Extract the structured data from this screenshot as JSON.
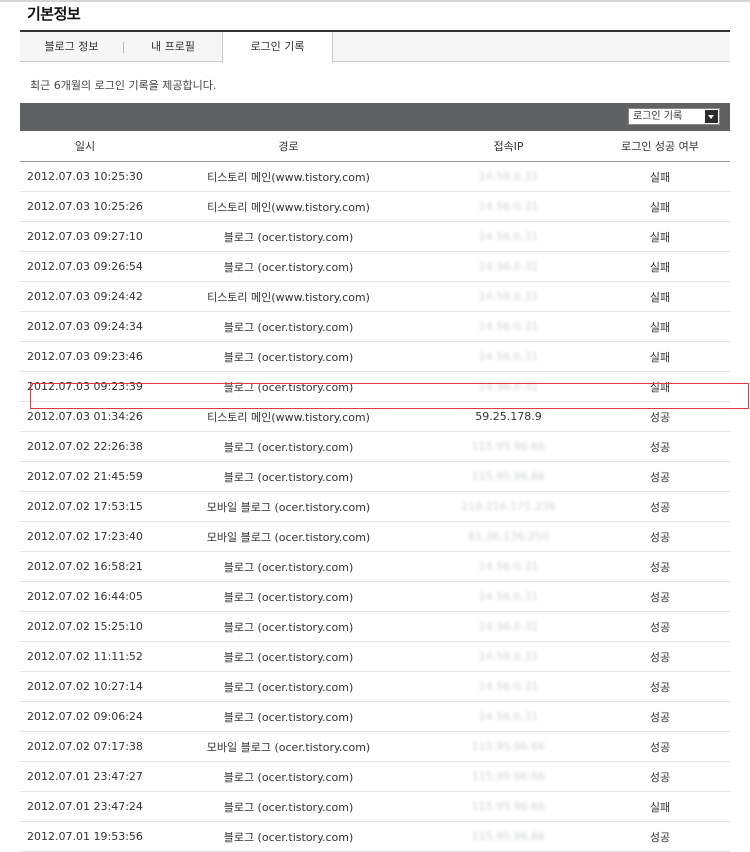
{
  "page": {
    "title": "기본정보"
  },
  "tabs": [
    {
      "label": "블로그 정보"
    },
    {
      "label": "내 프로필"
    },
    {
      "label": "로그인 기록"
    }
  ],
  "description": "최근 6개월의 로그인 기록을 제공합니다.",
  "filter": {
    "selected": "로그인 기록"
  },
  "table": {
    "headers": [
      "일시",
      "경로",
      "접속IP",
      "로그인 성공 여부"
    ],
    "rows": [
      {
        "date": "2012.07.03 10:25:30",
        "route": "티스토리 메인(www.tistory.com)",
        "ip": "14.56.0.31",
        "result": "실패"
      },
      {
        "date": "2012.07.03 10:25:26",
        "route": "티스토리 메인(www.tistory.com)",
        "ip": "14.56.0.31",
        "result": "실패"
      },
      {
        "date": "2012.07.03 09:27:10",
        "route": "블로그 (ocer.tistory.com)",
        "ip": "14.56.0.31",
        "result": "실패"
      },
      {
        "date": "2012.07.03 09:26:54",
        "route": "블로그 (ocer.tistory.com)",
        "ip": "14.56.0.31",
        "result": "실패"
      },
      {
        "date": "2012.07.03 09:24:42",
        "route": "티스토리 메인(www.tistory.com)",
        "ip": "14.56.0.31",
        "result": "실패"
      },
      {
        "date": "2012.07.03 09:24:34",
        "route": "블로그 (ocer.tistory.com)",
        "ip": "14.56.0.31",
        "result": "실패"
      },
      {
        "date": "2012.07.03 09:23:46",
        "route": "블로그 (ocer.tistory.com)",
        "ip": "14.56.0.31",
        "result": "실패"
      },
      {
        "date": "2012.07.03 09:23:39",
        "route": "블로그 (ocer.tistory.com)",
        "ip": "14.56.0.31",
        "result": "실패"
      },
      {
        "date": "2012.07.03 01:34:26",
        "route": "티스토리 메인(www.tistory.com)",
        "ip": "59.25.178.9",
        "result": "성공"
      },
      {
        "date": "2012.07.02 22:26:38",
        "route": "블로그 (ocer.tistory.com)",
        "ip": "115.95.96.66",
        "result": "성공"
      },
      {
        "date": "2012.07.02 21:45:59",
        "route": "블로그 (ocer.tistory.com)",
        "ip": "115.95.96.66",
        "result": "성공"
      },
      {
        "date": "2012.07.02 17:53:15",
        "route": "모바일 블로그 (ocer.tistory.com)",
        "ip": "210.216.171.238",
        "result": "성공"
      },
      {
        "date": "2012.07.02 17:23:40",
        "route": "모바일 블로그 (ocer.tistory.com)",
        "ip": "61.36.136.250",
        "result": "성공"
      },
      {
        "date": "2012.07.02 16:58:21",
        "route": "블로그 (ocer.tistory.com)",
        "ip": "14.56.0.31",
        "result": "성공"
      },
      {
        "date": "2012.07.02 16:44:05",
        "route": "블로그 (ocer.tistory.com)",
        "ip": "14.56.0.31",
        "result": "성공"
      },
      {
        "date": "2012.07.02 15:25:10",
        "route": "블로그 (ocer.tistory.com)",
        "ip": "14.56.0.31",
        "result": "성공"
      },
      {
        "date": "2012.07.02 11:11:52",
        "route": "블로그 (ocer.tistory.com)",
        "ip": "14.56.0.31",
        "result": "성공"
      },
      {
        "date": "2012.07.02 10:27:14",
        "route": "블로그 (ocer.tistory.com)",
        "ip": "14.56.0.31",
        "result": "성공"
      },
      {
        "date": "2012.07.02 09:06:24",
        "route": "블로그 (ocer.tistory.com)",
        "ip": "14.56.0.31",
        "result": "성공"
      },
      {
        "date": "2012.07.02 07:17:38",
        "route": "모바일 블로그 (ocer.tistory.com)",
        "ip": "115.95.96.66",
        "result": "성공"
      },
      {
        "date": "2012.07.01 23:47:27",
        "route": "블로그 (ocer.tistory.com)",
        "ip": "115.95.96.66",
        "result": "성공"
      },
      {
        "date": "2012.07.01 23:47:24",
        "route": "블로그 (ocer.tistory.com)",
        "ip": "115.95.96.66",
        "result": "실패"
      },
      {
        "date": "2012.07.01 19:53:56",
        "route": "블로그 (ocer.tistory.com)",
        "ip": "115.95.96.66",
        "result": "성공"
      }
    ]
  }
}
